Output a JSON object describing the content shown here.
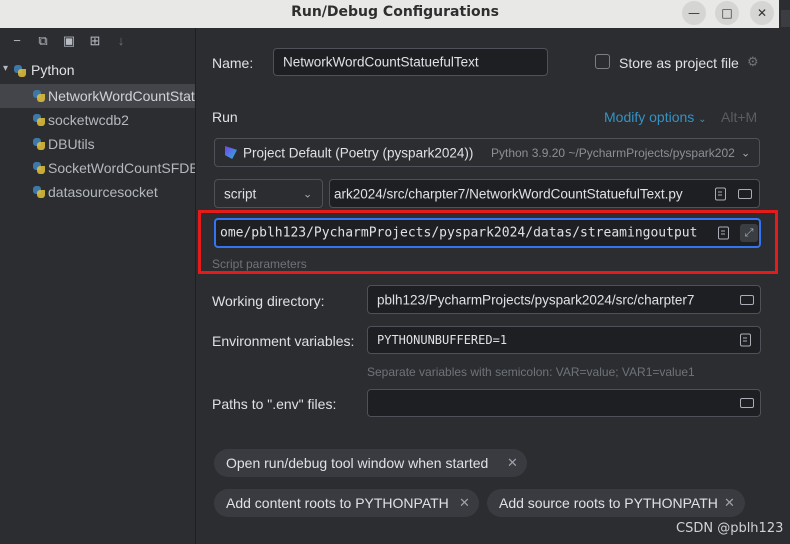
{
  "window": {
    "title": "Run/Debug Configurations",
    "minimize_glyph": "—",
    "maximize_glyph": "□",
    "close_glyph": "✕"
  },
  "toolbar": {
    "icons": [
      "remove-icon",
      "copy-icon",
      "save-icon",
      "folder-plus-icon",
      "sort-icon"
    ]
  },
  "tree": {
    "root_label": "Python",
    "items": [
      {
        "label": "NetworkWordCountStatuefulText",
        "selected": true
      },
      {
        "label": "socketwcdb2",
        "selected": false
      },
      {
        "label": "DBUtils",
        "selected": false
      },
      {
        "label": "SocketWordCountSFDB",
        "selected": false
      },
      {
        "label": "datasourcesocket",
        "selected": false
      }
    ]
  },
  "config": {
    "name_label": "Name:",
    "name_value": "NetworkWordCountStatuefulText",
    "store_label": "Store as project file",
    "store_checked": false,
    "run_section": "Run",
    "modify_options": "Modify options",
    "modify_shortcut": "Alt+M",
    "interpreter_name": "Project Default (Poetry (pyspark2024))",
    "interpreter_detail": "Python 3.9.20 ~/PycharmProjects/pyspark202",
    "script_type": "script",
    "script_path": "ark2024/src/charpter7/NetworkWordCountStatuefulText.py",
    "params_value": "ome/pblh123/PycharmProjects/pyspark2024/datas/streamingoutput",
    "params_hint": "Script parameters",
    "workdir_label": "Working directory:",
    "workdir_value": "pblh123/PycharmProjects/pyspark2024/src/charpter7",
    "env_label": "Environment variables:",
    "env_value": "PYTHONUNBUFFERED=1",
    "env_hint": "Separate variables with semicolon: VAR=value; VAR1=value1",
    "dotenv_label": "Paths to \".env\" files:",
    "dotenv_value": ""
  },
  "chips": [
    {
      "label": "Open run/debug tool window when started"
    },
    {
      "label": "Add content roots to PYTHONPATH"
    },
    {
      "label": "Add source roots to PYTHONPATH"
    }
  ],
  "watermark": "CSDN @pblh123",
  "colors": {
    "accent_link": "#3592c4",
    "highlight_box": "#e51b1b",
    "focus_border": "#3574f0"
  }
}
